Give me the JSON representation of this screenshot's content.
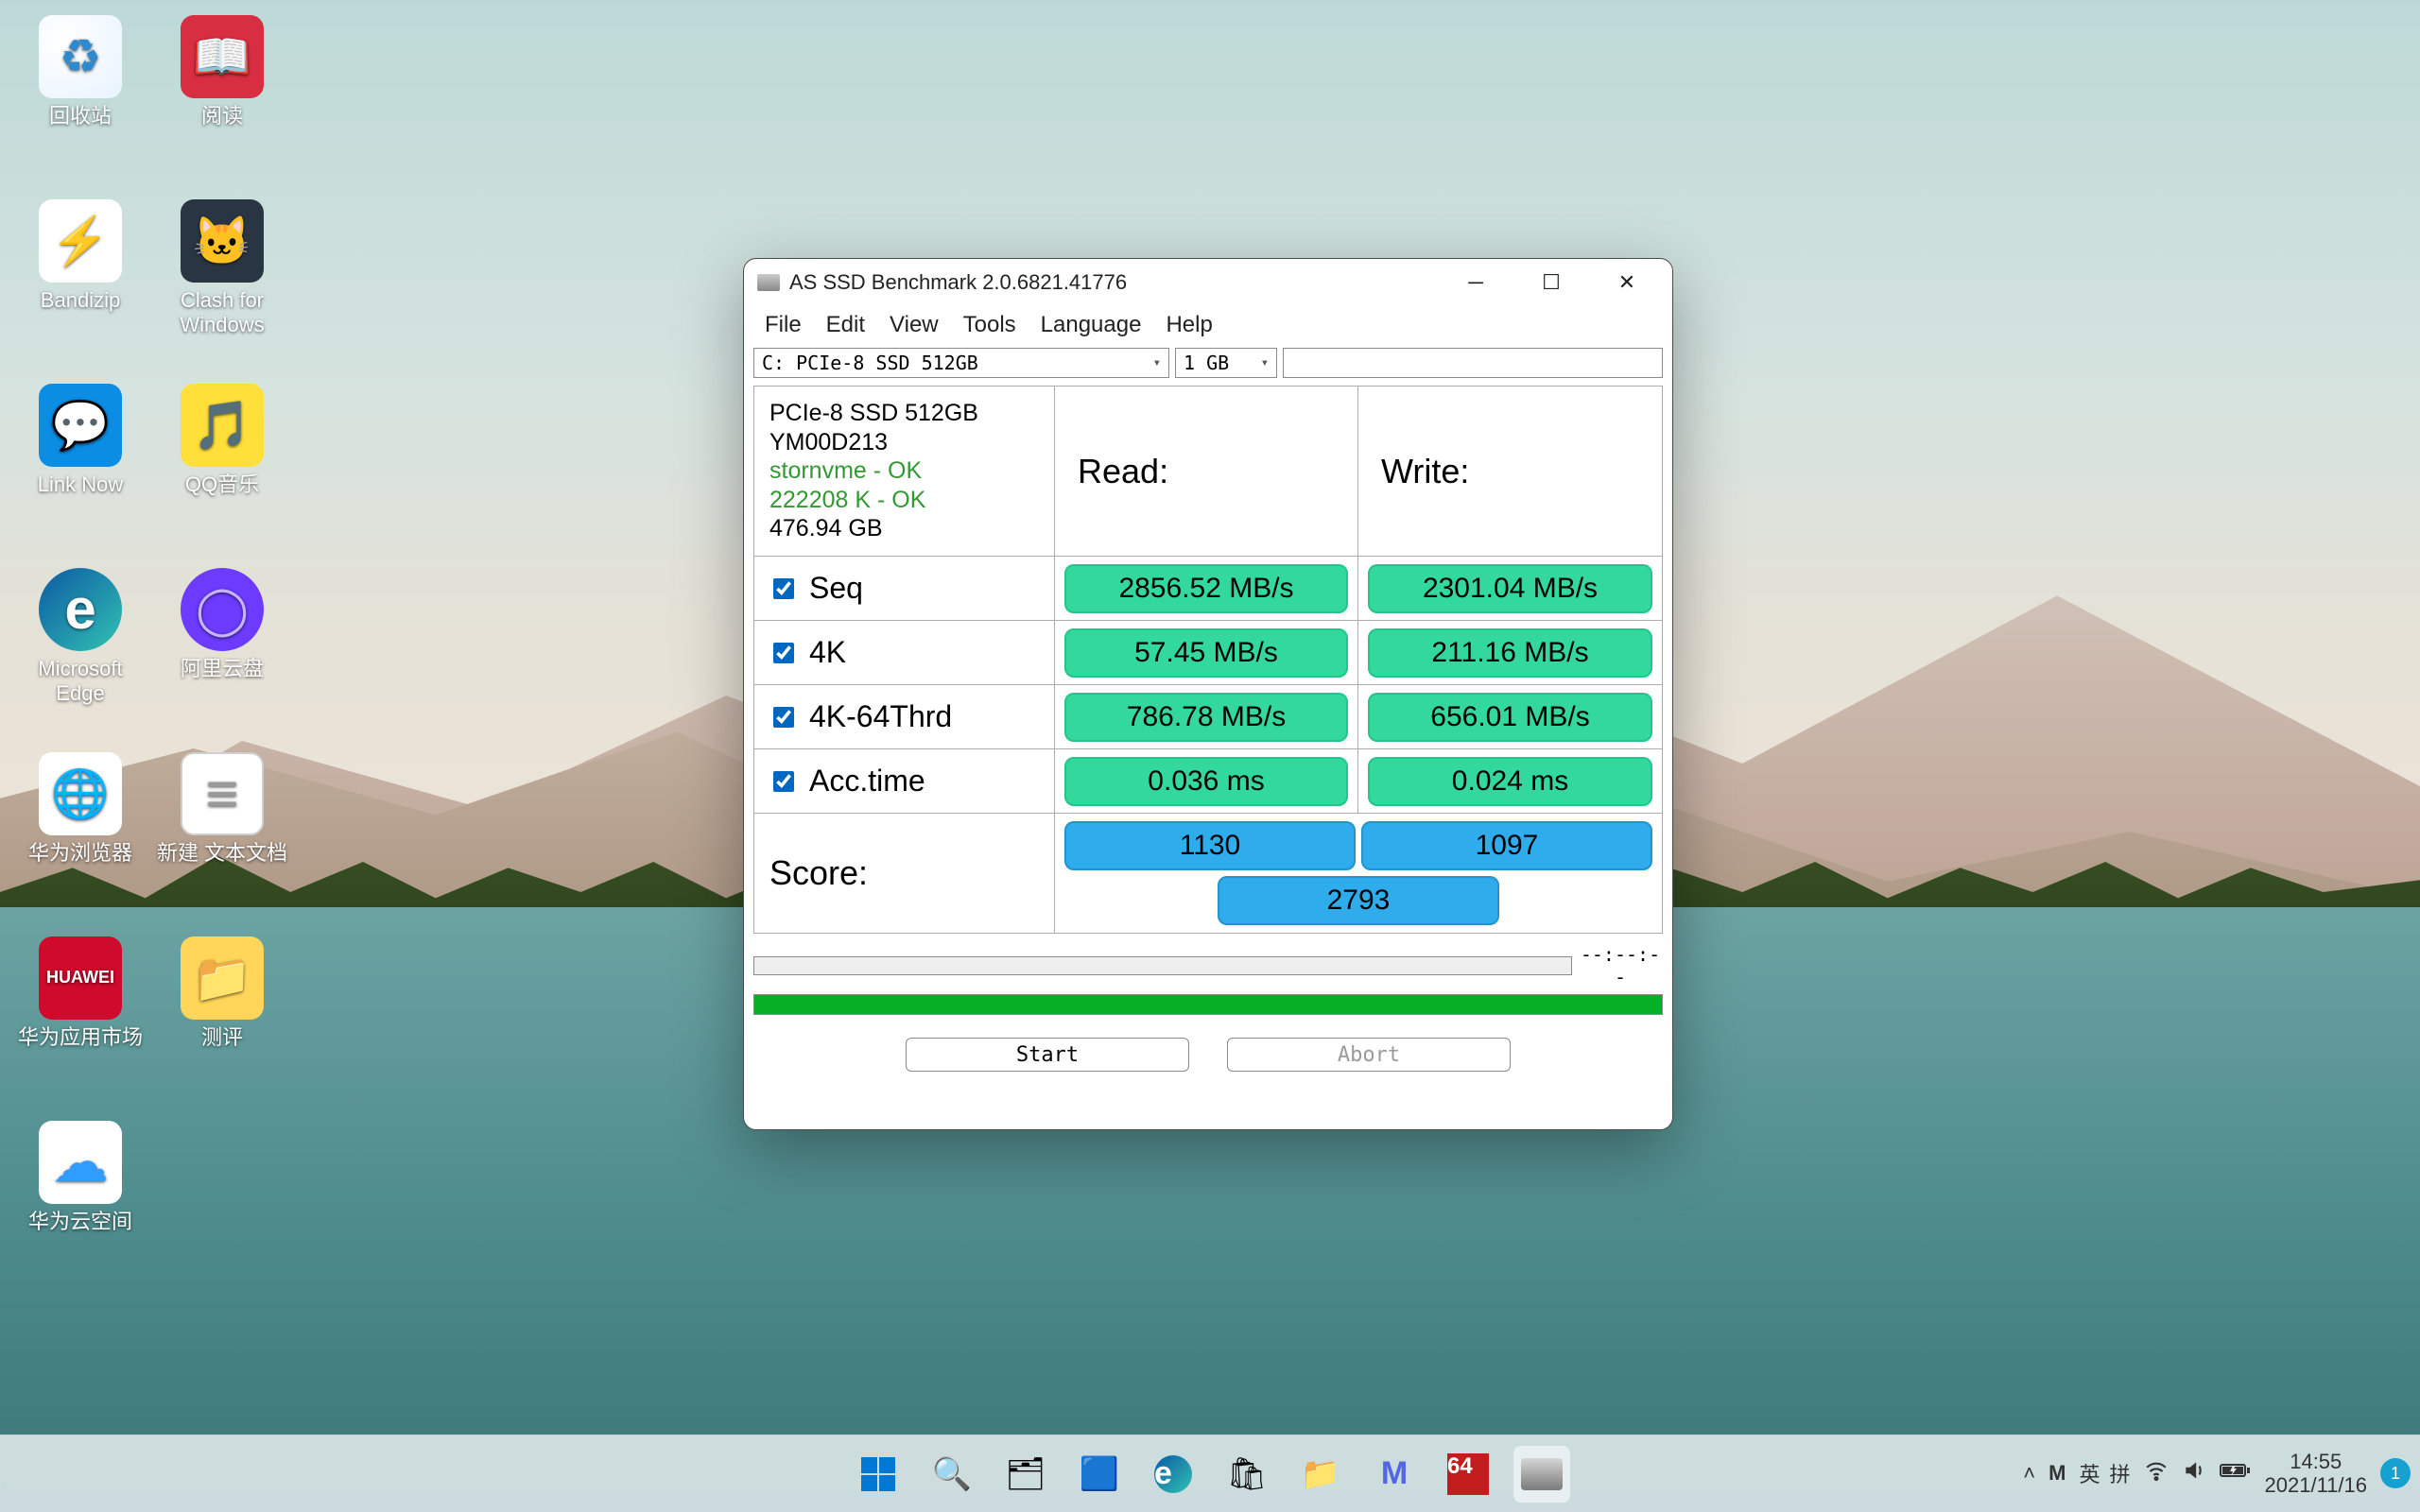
{
  "desktop": {
    "icons": [
      {
        "label": "回收站",
        "cls": "ic-recycle",
        "name": "recycle-bin"
      },
      {
        "label": "阅读",
        "cls": "ic-read",
        "name": "read-app"
      },
      {
        "label": "Bandizip",
        "cls": "ic-bandizip",
        "name": "bandizip"
      },
      {
        "label": "Clash for Windows",
        "cls": "ic-clash",
        "name": "clash-for-windows"
      },
      {
        "label": "Link Now",
        "cls": "ic-linknow",
        "name": "link-now"
      },
      {
        "label": "QQ音乐",
        "cls": "ic-qqmusic",
        "name": "qq-music"
      },
      {
        "label": "Microsoft Edge",
        "cls": "ic-edge",
        "name": "microsoft-edge"
      },
      {
        "label": "阿里云盘",
        "cls": "ic-aliyun",
        "name": "aliyun-drive"
      },
      {
        "label": "华为浏览器",
        "cls": "ic-hwbrowser",
        "name": "huawei-browser"
      },
      {
        "label": "新建 文本文档",
        "cls": "ic-txt",
        "name": "new-text-document"
      },
      {
        "label": "华为应用市场",
        "cls": "ic-huawei",
        "name": "huawei-appgallery"
      },
      {
        "label": "测评",
        "cls": "ic-folder",
        "name": "review-folder"
      },
      {
        "label": "华为云空间",
        "cls": "ic-hwcloud",
        "name": "huawei-cloud"
      }
    ]
  },
  "window": {
    "title": "AS SSD Benchmark 2.0.6821.41776",
    "menus": [
      "File",
      "Edit",
      "View",
      "Tools",
      "Language",
      "Help"
    ],
    "drive_select": "C: PCIe-8 SSD 512GB",
    "size_select": "1 GB",
    "drive_info": {
      "name": "PCIe-8 SSD 512GB",
      "firmware": "YM00D213",
      "driver": "stornvme - OK",
      "align": "222208 K - OK",
      "capacity": "476.94 GB"
    },
    "headers": {
      "read": "Read:",
      "write": "Write:"
    },
    "rows": [
      {
        "label": "Seq",
        "read": "2856.52 MB/s",
        "write": "2301.04 MB/s"
      },
      {
        "label": "4K",
        "read": "57.45 MB/s",
        "write": "211.16 MB/s"
      },
      {
        "label": "4K-64Thrd",
        "read": "786.78 MB/s",
        "write": "656.01 MB/s"
      },
      {
        "label": "Acc.time",
        "read": "0.036 ms",
        "write": "0.024 ms"
      }
    ],
    "score_label": "Score:",
    "scores": {
      "read": "1130",
      "write": "1097",
      "total": "2793"
    },
    "timer": "--:--:--",
    "buttons": {
      "start": "Start",
      "abort": "Abort"
    }
  },
  "taskbar": {
    "tray": {
      "chevron": "˄",
      "brand": "M",
      "ime1": "英",
      "ime2": "拼"
    },
    "clock": {
      "time": "14:55",
      "date": "2021/11/16"
    },
    "notif_count": "1"
  }
}
